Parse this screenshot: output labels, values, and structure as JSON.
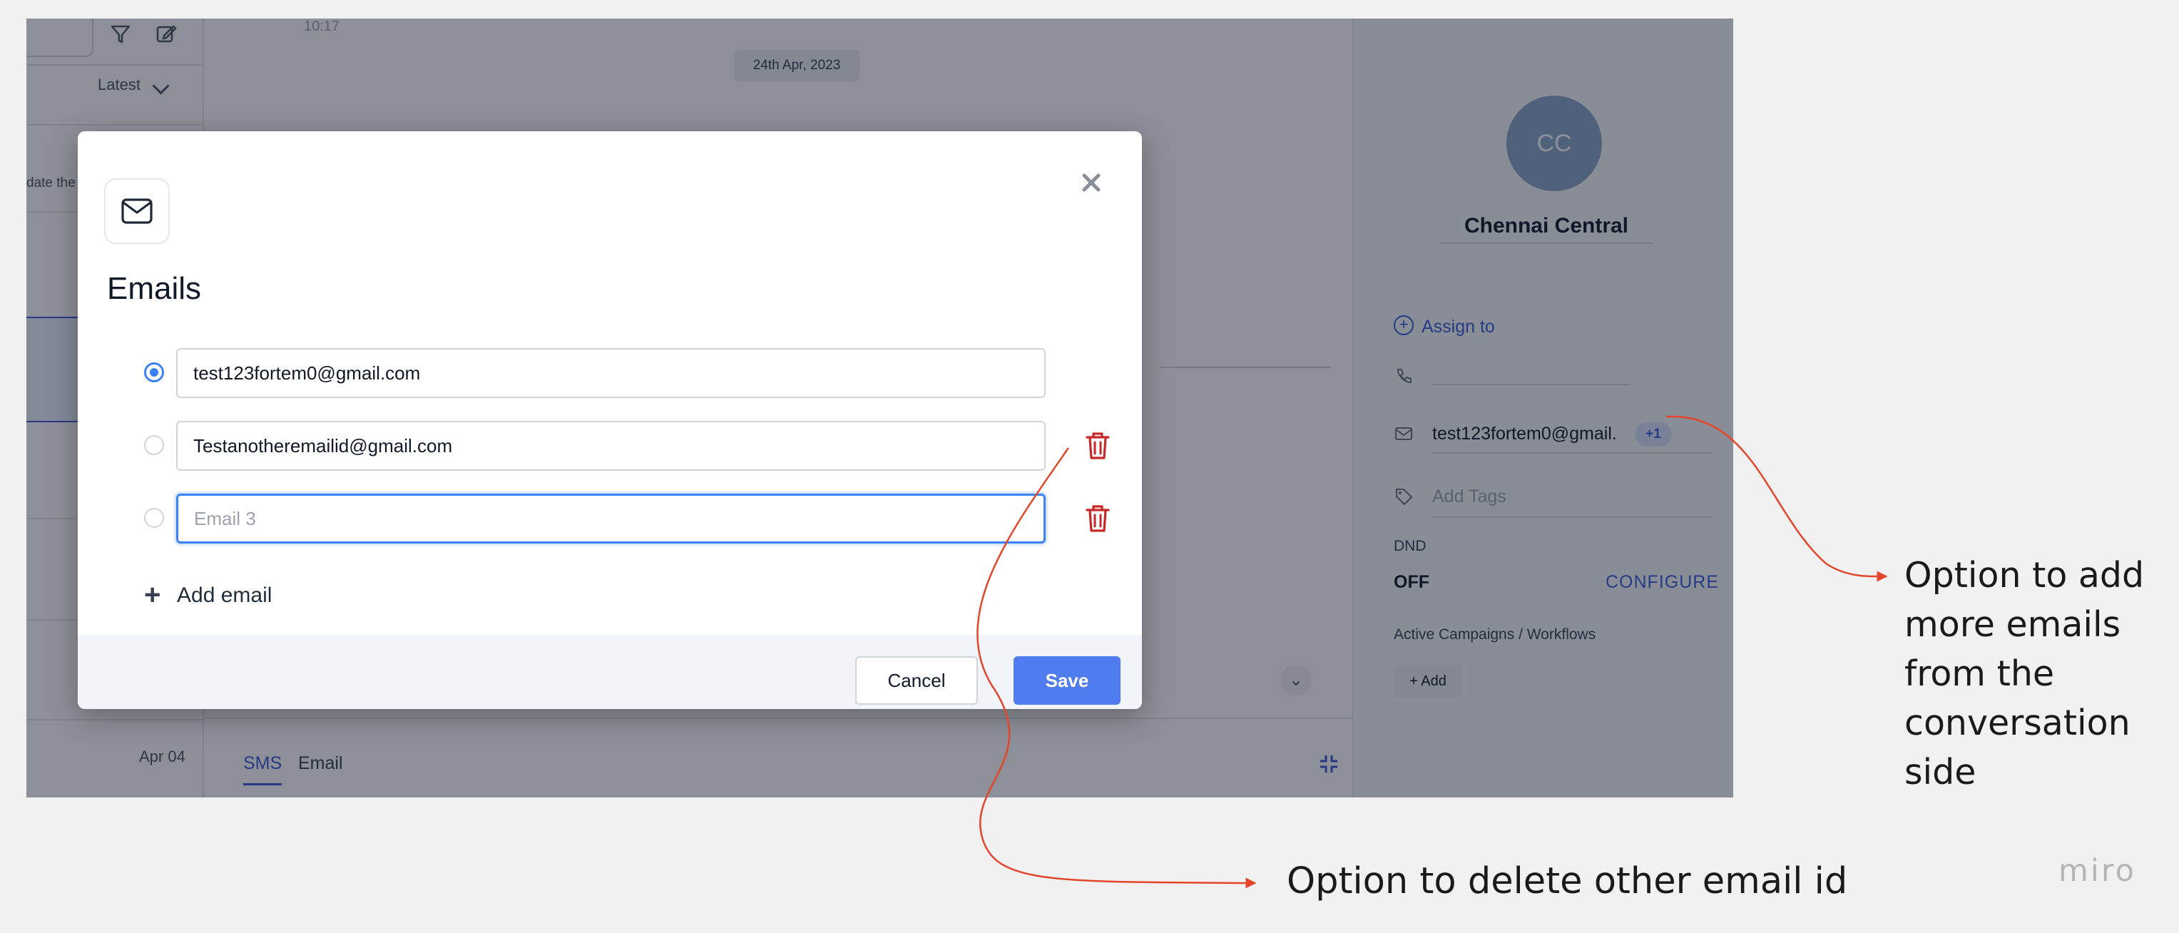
{
  "app": {
    "left_panel": {
      "sort_label": "Latest",
      "snippet": "date the",
      "conversation_date": "Apr 04"
    },
    "conversation": {
      "time_snippet": "10:17",
      "date_divider": "24th Apr, 2023",
      "tabs": [
        {
          "label": "SMS",
          "active": true
        },
        {
          "label": "Email",
          "active": false
        }
      ]
    },
    "contact": {
      "initials": "CC",
      "name": "Chennai Central",
      "assign_label": "Assign to",
      "email": "test123fortem0@gmail.",
      "extra_email_count": "+1",
      "tags_placeholder": "Add Tags",
      "dnd_label": "DND",
      "dnd_value": "OFF",
      "configure_label": "CONFIGURE",
      "campaigns_label": "Active Campaigns / Workflows",
      "add_label": "Add"
    }
  },
  "modal": {
    "title": "Emails",
    "emails": [
      {
        "value": "test123fortem0@gmail.com",
        "placeholder": "",
        "primary": true,
        "deletable": false,
        "focused": false
      },
      {
        "value": "Testanotheremailid@gmail.com",
        "placeholder": "",
        "primary": false,
        "deletable": true,
        "focused": false
      },
      {
        "value": "",
        "placeholder": "Email 3",
        "primary": false,
        "deletable": true,
        "focused": true
      }
    ],
    "add_email_label": "Add email",
    "cancel_label": "Cancel",
    "save_label": "Save"
  },
  "annotations": {
    "right": "Option to add more emails from the conversation side",
    "bottom": "Option to delete other email id",
    "color": "#e3462b"
  },
  "watermark": "miro",
  "colors": {
    "primary": "#3b82f6",
    "save_button": "#4f7df0",
    "delete_icon": "#c62828",
    "overlay": "rgba(17,24,39,0.48)"
  }
}
